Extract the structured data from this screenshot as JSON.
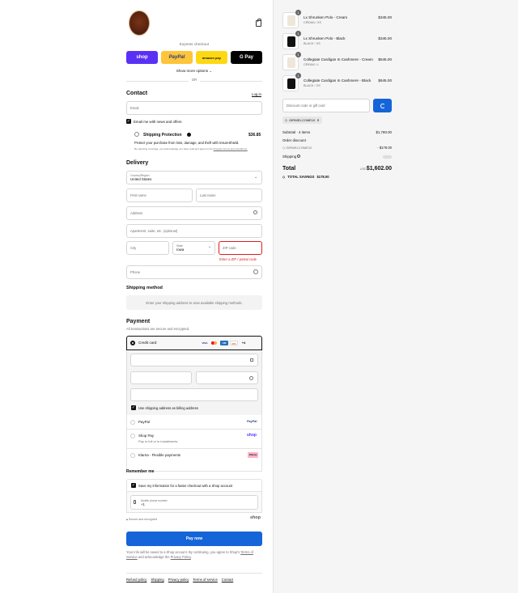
{
  "header": {
    "express_checkout": "Express checkout",
    "show_more": "Show more options",
    "or": "OR"
  },
  "express": {
    "shop": "shop",
    "paypal": "PayPal",
    "amazon": "amazon pay",
    "gpay": "G Pay"
  },
  "contact": {
    "title": "Contact",
    "login": "Log in",
    "email_placeholder": "Email",
    "news_label": "Email me with news and offers",
    "protection_title": "Shipping Protection",
    "protection_price": "$36.85",
    "protection_desc": "Protect your purchase from loss, damage, and theft with InsureShield.",
    "protection_fine": "By selecting coverage, you acknowledge you have read and agree to the",
    "protection_fine_link": "Program Terms and Conditions."
  },
  "delivery": {
    "title": "Delivery",
    "country_label": "Country/Region",
    "country_value": "United States",
    "first_name": "First name",
    "last_name": "Last name",
    "address": "Address",
    "apartment": "Apartment, suite, etc. (optional)",
    "city": "City",
    "state_label": "State",
    "state_value": "Iowa",
    "zip": "ZIP code",
    "zip_error": "Enter a ZIP / postal code",
    "phone": "Phone"
  },
  "shipping_method": {
    "title": "Shipping method",
    "message": "Enter your shipping address to view available shipping methods."
  },
  "payment": {
    "title": "Payment",
    "subtitle": "All transactions are secure and encrypted.",
    "credit_card": "Credit card",
    "more_cards": "+4",
    "billing_label": "Use shipping address as billing address",
    "paypal": "PayPal",
    "shop_pay": "Shop Pay",
    "shop_pay_sub": "Pay in full or in installments",
    "klarna": "Klarna - Flexible payments",
    "klarna_badge": "Klarna",
    "paypal_logo": "PayPal",
    "shop_logo": "shop"
  },
  "remember": {
    "title": "Remember me",
    "save_label": "Save my information for a faster checkout with a Shop account",
    "mobile_label": "Mobile phone number",
    "mobile_prefix": "+1",
    "secure": "Secure and encrypted",
    "shop": "shop"
  },
  "pay_now": "Pay now",
  "legal": {
    "text1": "Your info will be saved to a Shop account. By continuing, you agree to Shop's",
    "tos": "Terms of Service",
    "text2": "and acknowledge the",
    "privacy": "Privacy Policy",
    "dot": "."
  },
  "footer": [
    "Refund policy",
    "Shipping",
    "Privacy policy",
    "Terms of service",
    "Contact"
  ],
  "cart": {
    "items": [
      {
        "qty": "1",
        "name": "Lx Shrunken Polo - Cream",
        "variant": "CREAM / XS",
        "price": "$345.00",
        "color": "#efe6da"
      },
      {
        "qty": "1",
        "name": "Lx Shrunken Polo - Black",
        "variant": "BLACK / XS",
        "price": "$345.00",
        "color": "#111111"
      },
      {
        "qty": "1",
        "name": "Collegiate Cardigan In Cashmere - Cream",
        "variant": "CREAM / L",
        "price": "$545.00",
        "color": "#efe6da"
      },
      {
        "qty": "1",
        "name": "Collegiate Cardigan In Cashmere - Black",
        "variant": "BLACK / XS",
        "price": "$645.00",
        "color": "#111111"
      }
    ],
    "discount_placeholder": "Discount code or gift card",
    "applied_code": "GIRWELCOME10",
    "subtotal_label": "Subtotal · 4 items",
    "subtotal": "$1,780.00",
    "order_discount": "Order discount",
    "discount_code": "GIRWELCOME10",
    "discount_amount": "- $178.00",
    "shipping_label": "Shipping",
    "total_label": "Total",
    "currency": "USD",
    "total": "$1,602.00",
    "savings_label": "TOTAL SAVINGS",
    "savings": "$178.00"
  }
}
